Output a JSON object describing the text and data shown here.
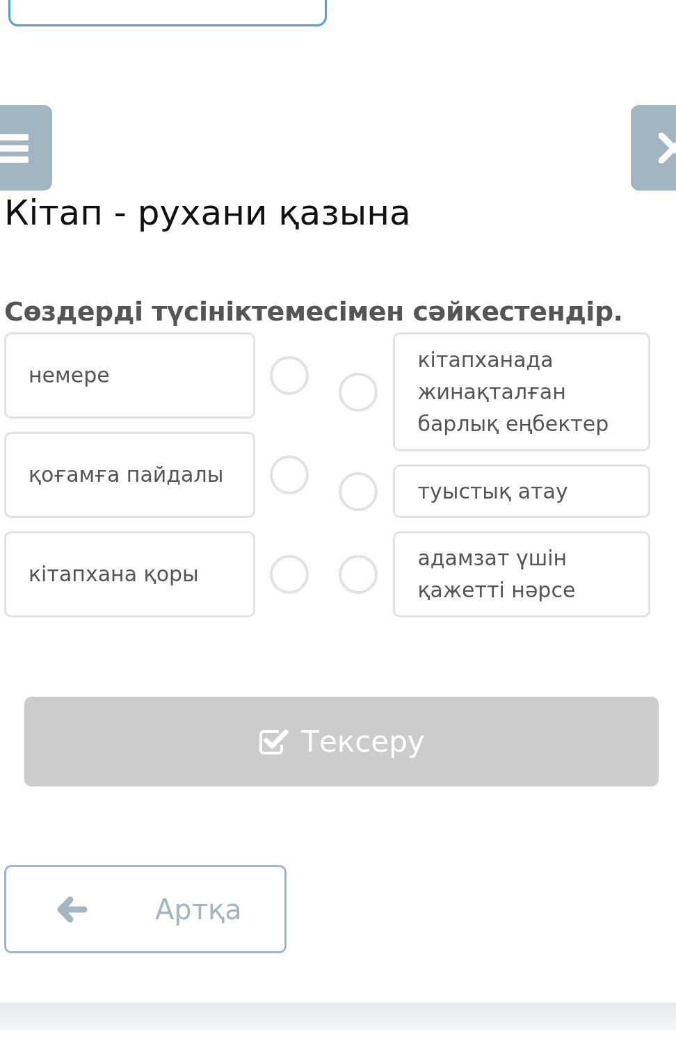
{
  "title": "Кітап - рухани қазына",
  "instruction": "Сөздерді түсініктемесімен сәйкестендір.",
  "left_items": [
    {
      "text": "немере",
      "selected": false
    },
    {
      "text": "қоғамға пайдалы",
      "selected": false
    },
    {
      "text": "кітапхана қоры",
      "selected": false
    }
  ],
  "right_items": [
    {
      "text": "кітапханада жинақталған барлық еңбектер",
      "selected": false
    },
    {
      "text": "туыстық атау",
      "selected": false
    },
    {
      "text": "адамзат үшін қажетті нәрсе",
      "selected": false
    }
  ],
  "check_button": {
    "label": "Тексеру",
    "disabled": true
  },
  "back_button": {
    "label": "Артқа"
  }
}
